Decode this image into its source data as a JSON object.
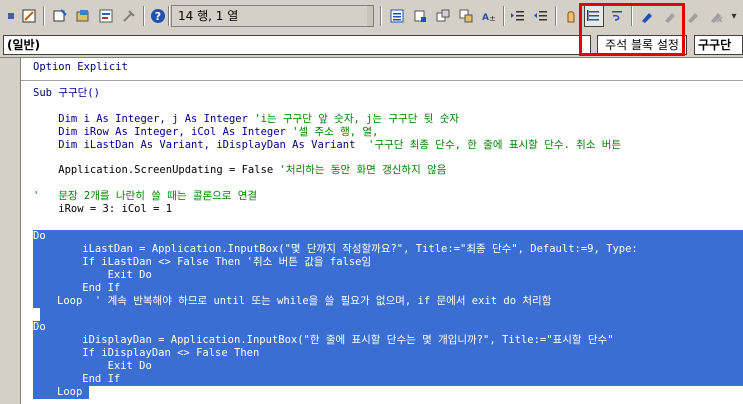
{
  "toolbar": {
    "status_text": "14 행, 1 열",
    "icons": [
      "view-excel-icon",
      "insert-object-icon",
      "edit-tools-icon",
      "properties-icon",
      "object-browser-icon",
      "toolbox-icon",
      "help-icon",
      "indent-icon",
      "outdent-icon",
      "list-properties-icon",
      "list-constants-icon",
      "quick-info-icon",
      "parameter-info-icon",
      "complete-word-icon",
      "comment-block-icon",
      "uncomment-block-icon",
      "toggle-breakpoint-icon",
      "toggle-bookmark-icon",
      "next-bookmark-icon",
      "previous-bookmark-icon",
      "clear-bookmarks-icon"
    ]
  },
  "combo": {
    "object": "(일반)",
    "comment_block_tooltip": "주석 블록 설정",
    "procedure": "구구단"
  },
  "code": {
    "line1": "Option Explicit",
    "line2": "Sub 구구단()",
    "line3a": "    Dim i As Integer, j As Integer ",
    "line3b": "'i는 구구단 앞 숫자, j는 구구단 뒷 숫자",
    "line4a": "    Dim iRow As Integer, iCol As Integer ",
    "line4b": "'셀 주소 행, 열,",
    "line5a": "    Dim iLastDan As Variant, iDisplayDan As Variant  ",
    "line5b": "'구구단 최종 단수, 한 줄에 표시할 단수. 취소 버튼",
    "line6a": "    Application.ScreenUpdating = False ",
    "line6b": "'처리하는 동안 화면 갱신하지 않음",
    "line7": "'   문장 2개를 나란히 쓸 때는 콜론으로 연결",
    "line8": "    iRow = 3: iCol = 1",
    "line9": "Do",
    "line10": "    iLastDan = Application.InputBox(\"몇 단까지 작성할까요?\", Title:=\"최종 단수\", Default:=9, Type:",
    "line11": "    If iLastDan <> False Then '취소 버튼 값을 false임",
    "line12": "        Exit Do",
    "line13": "    End If",
    "line14": "Loop  ' 계속 반복해야 하므로 until 또는 while을 쓸 필요가 없으며, if 문에서 exit do 처리함",
    "line15": "Do",
    "line16": "    iDisplayDan = Application.InputBox(\"한 줄에 표시할 단수는 몇 개입니까?\", Title:=\"표시할 단수\"",
    "line17": "    If iDisplayDan <> False Then",
    "line18": "        Exit Do",
    "line19": "    End If",
    "line20": "Loop"
  }
}
